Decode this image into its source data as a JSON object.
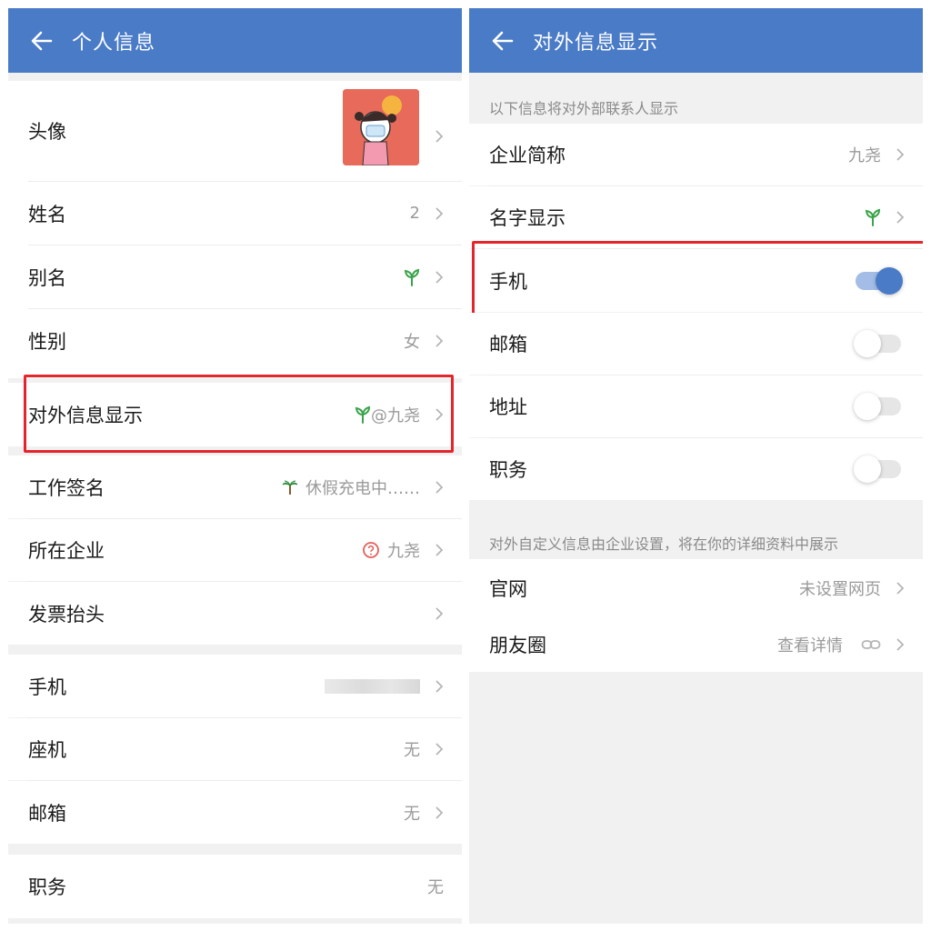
{
  "left": {
    "header_title": "个人信息",
    "rows": [
      {
        "label": "头像",
        "value": ""
      },
      {
        "label": "姓名",
        "value": "2"
      },
      {
        "label": "别名",
        "value": ""
      },
      {
        "label": "性别",
        "value": "女"
      },
      {
        "label": "对外信息显示",
        "value": "@九尧"
      },
      {
        "label": "工作签名",
        "value": "休假充电中……"
      },
      {
        "label": "所在企业",
        "value": "九尧"
      },
      {
        "label": "发票抬头",
        "value": ""
      },
      {
        "label": "手机",
        "value": ""
      },
      {
        "label": "座机",
        "value": "无"
      },
      {
        "label": "邮箱",
        "value": "无"
      },
      {
        "label": "职务",
        "value": "无"
      }
    ]
  },
  "right": {
    "header_title": "对外信息显示",
    "section1_note": "以下信息将对外部联系人显示",
    "rows": [
      {
        "label": "企业简称",
        "value": "九尧"
      },
      {
        "label": "名字显示",
        "value": ""
      },
      {
        "label": "手机",
        "toggle_on": true
      },
      {
        "label": "邮箱",
        "toggle_on": false
      },
      {
        "label": "地址",
        "toggle_on": false
      },
      {
        "label": "职务",
        "toggle_on": false
      }
    ],
    "section2_note": "对外自定义信息由企业设置，将在你的详细资料中展示",
    "custom_rows": [
      {
        "label": "官网",
        "value": "未设置网页"
      },
      {
        "label": "朋友圈",
        "value": "查看详情"
      }
    ]
  },
  "colors": {
    "header": "#4a7bc7",
    "highlight_box": "#e4252b",
    "toggle_on": "#4a7bc7",
    "brand_orange": "#e0942b",
    "sprout_green": "#3aa34a"
  },
  "icons": [
    "back-arrow-icon",
    "chevron-right-icon",
    "sprout-icon",
    "palm-tree-icon",
    "question-circle-icon",
    "link-icon"
  ]
}
